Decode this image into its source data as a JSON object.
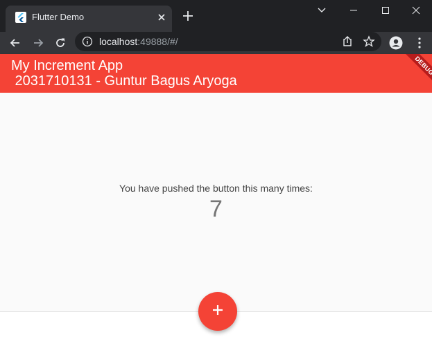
{
  "browser": {
    "tab_title": "Flutter Demo",
    "url_host": "localhost",
    "url_rest": ":49888/#/"
  },
  "app": {
    "title": "My Increment App\n 2031710131 - Guntur Bagus Aryoga",
    "debug_banner": "DEBUG",
    "counter_label": "You have pushed the button this many times:",
    "counter_value": "7",
    "accent_color": "#f44336"
  },
  "icons": {
    "fab": "add-icon",
    "tab": "flutter-icon"
  }
}
